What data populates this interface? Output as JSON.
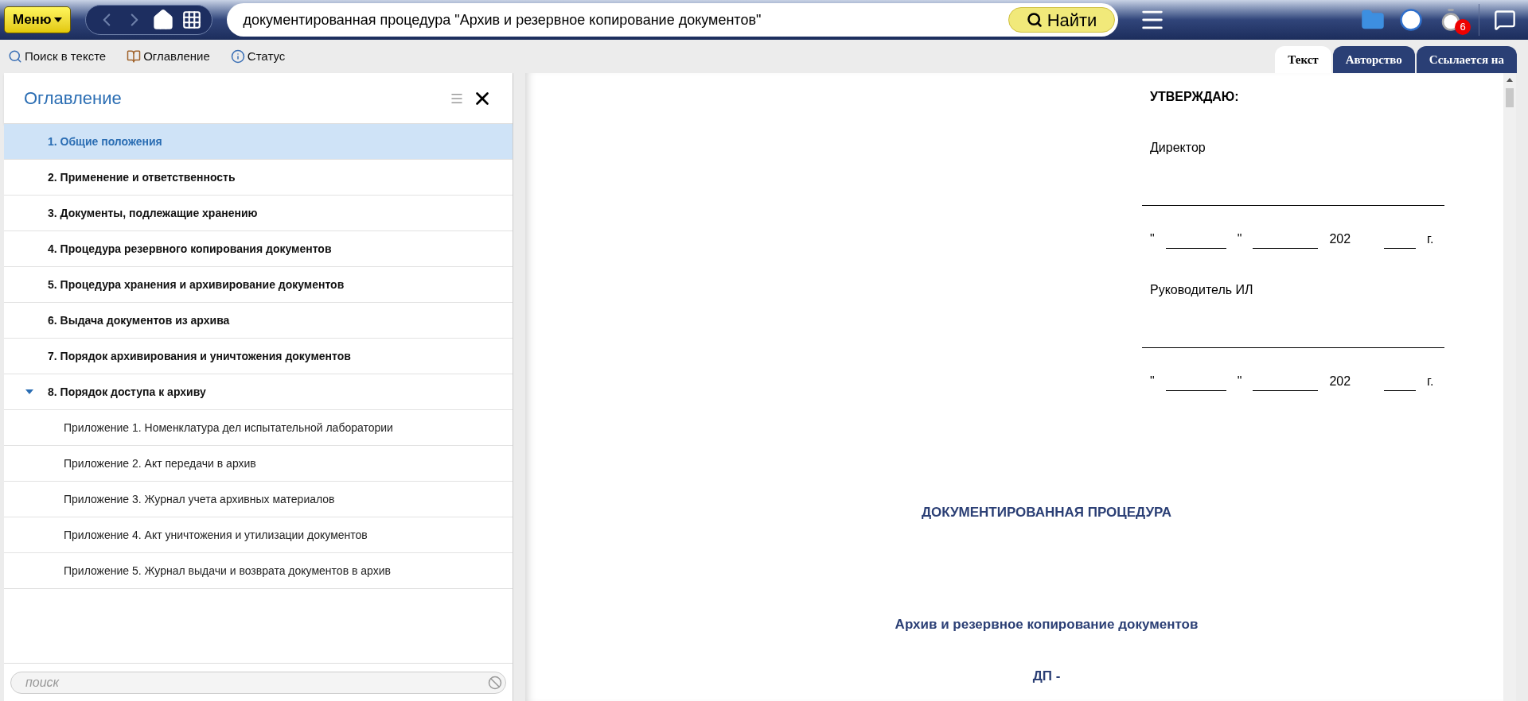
{
  "topbar": {
    "menu_button": "Меню",
    "search": {
      "value": "документированная процедура \"Архив и резервное копирование документов\""
    },
    "find_button": "Найти",
    "timer_badge": "6"
  },
  "toolbar": [
    "Поиск в тексте",
    "Оглавление",
    "Статус"
  ],
  "tabs": [
    {
      "label": "Текст",
      "selected": true
    },
    {
      "label": "Авторство",
      "selected": false
    },
    {
      "label": "Ссылается на",
      "selected": false
    }
  ],
  "toc": {
    "title": "Оглавление",
    "items": [
      {
        "label": "1. Общие положения",
        "selected": true
      },
      {
        "label": "2. Применение и ответственность",
        "selected": false
      },
      {
        "label": "3. Документы, подлежащие хранению",
        "selected": false
      },
      {
        "label": "4. Процедура резервного копирования документов",
        "selected": false
      },
      {
        "label": "5. Процедура хранения и архивирование документов",
        "selected": false
      },
      {
        "label": "6. Выдача документов из архива",
        "selected": false
      },
      {
        "label": "7. Порядок архивирования и уничтожения документов",
        "selected": false
      },
      {
        "label": "8. Порядок доступа к архиву",
        "selected": false,
        "expanded": true,
        "children": [
          {
            "label": "Приложение 1. Номенклатура дел испытательной лаборатории",
            "selected": false
          },
          {
            "label": "Приложение 2. Акт передачи в архив",
            "selected": false
          },
          {
            "label": "Приложение 3. Журнал учета архивных материалов",
            "selected": false
          },
          {
            "label": "Приложение 4. Акт уничтожения и утилизации документов",
            "selected": false
          },
          {
            "label": "Приложение 5. Журнал выдачи и возврата документов в архив",
            "selected": false
          }
        ]
      }
    ],
    "search": {
      "placeholder": "поиск"
    }
  },
  "document": {
    "approve": "УТВЕРЖДАЮ:",
    "signers": [
      {
        "title": "Директор",
        "date": [
          "\"",
          "\"",
          "202",
          "г."
        ]
      },
      {
        "title": "Руководитель ИЛ",
        "date": [
          "\"",
          "\"",
          "202",
          "г."
        ]
      }
    ],
    "heading": "ДОКУМЕНТИРОВАННАЯ ПРОЦЕДУРА",
    "subtitle": "Архив и резервное копирование документов",
    "code": "ДП -"
  }
}
